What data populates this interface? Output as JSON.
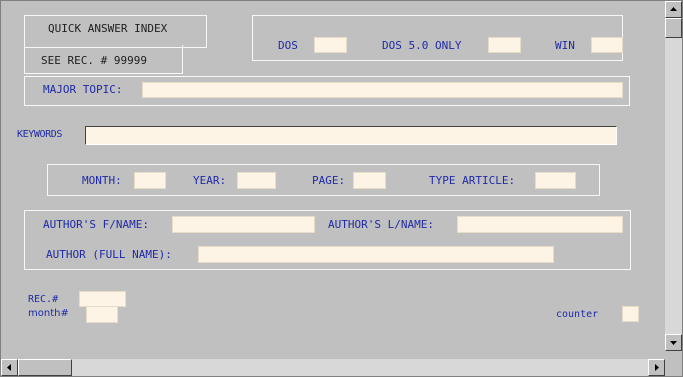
{
  "title_tab": {
    "title": "QUICK ANSWER INDEX",
    "see_rec": "SEE REC. # 99999"
  },
  "platform": {
    "dos_label": "DOS",
    "dos5_label": "DOS 5.0 ONLY",
    "win_label": "WIN"
  },
  "major_topic": {
    "label": "MAJOR TOPIC:",
    "value": ""
  },
  "keywords": {
    "label": "KEYWORDS",
    "value": ""
  },
  "date_row": {
    "month_label": "MONTH:",
    "year_label": "YEAR:",
    "page_label": "PAGE:",
    "type_label": "TYPE ARTICLE:"
  },
  "author": {
    "first_label": "AUTHOR'S F/NAME:",
    "last_label": "AUTHOR'S L/NAME:",
    "full_label": "AUTHOR (FULL NAME):"
  },
  "footer": {
    "rec_label": "REC.#",
    "month_label": "month#",
    "counter_label": "counter"
  },
  "colors": {
    "background": "#c0c0c0",
    "label_blue": "#1f2aa8",
    "field_fill": "#fdf4e6"
  },
  "icons": {
    "scroll_up": "triangle-up-icon",
    "scroll_down": "triangle-down-icon",
    "scroll_left": "triangle-left-icon",
    "scroll_right": "triangle-right-icon"
  }
}
